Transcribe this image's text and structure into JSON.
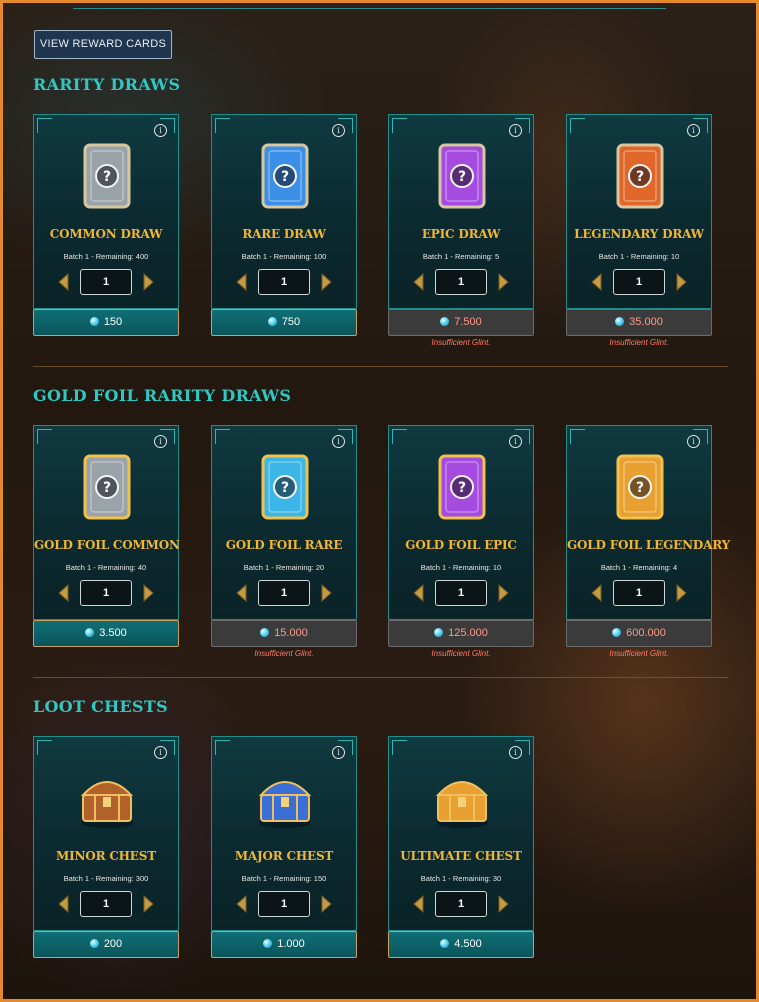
{
  "view_rewards_label": "VIEW REWARD CARDS",
  "sections": [
    {
      "title": "RARITY DRAWS",
      "cards": [
        {
          "name": "COMMON DRAW",
          "batch": "Batch 1 - Remaining: 400",
          "qty": "1",
          "price": "150",
          "affordable": true,
          "color": "#9aa3a8"
        },
        {
          "name": "RARE DRAW",
          "batch": "Batch 1 - Remaining: 100",
          "qty": "1",
          "price": "750",
          "affordable": true,
          "color": "#3b8fe6"
        },
        {
          "name": "EPIC DRAW",
          "batch": "Batch 1 - Remaining: 5",
          "qty": "1",
          "price": "7.500",
          "affordable": false,
          "error": "Insufficient Glint.",
          "color": "#a64be0"
        },
        {
          "name": "LEGENDARY DRAW",
          "batch": "Batch 1 - Remaining: 10",
          "qty": "1",
          "price": "35.000",
          "affordable": false,
          "error": "Insufficient Glint.",
          "color": "#e0662a"
        }
      ]
    },
    {
      "title": "GOLD FOIL RARITY DRAWS",
      "cards": [
        {
          "name": "GOLD FOIL COMMON",
          "batch": "Batch 1 - Remaining: 40",
          "qty": "1",
          "price": "3.500",
          "affordable": true,
          "color": "#9aa3a8"
        },
        {
          "name": "GOLD FOIL RARE",
          "batch": "Batch 1 - Remaining: 20",
          "qty": "1",
          "price": "15.000",
          "affordable": false,
          "error": "Insufficient Glint.",
          "color": "#3bb6e6"
        },
        {
          "name": "GOLD FOIL EPIC",
          "batch": "Batch 1 - Remaining: 10",
          "qty": "1",
          "price": "125.000",
          "affordable": false,
          "error": "Insufficient Glint.",
          "color": "#a64be0"
        },
        {
          "name": "GOLD FOIL LEGENDARY",
          "batch": "Batch 1 - Remaining: 4",
          "qty": "1",
          "price": "600.000",
          "affordable": false,
          "error": "Insufficient Glint.",
          "color": "#e8a030"
        }
      ]
    },
    {
      "title": "LOOT CHESTS",
      "cards": [
        {
          "name": "MINOR CHEST",
          "batch": "Batch 1 - Remaining: 300",
          "qty": "1",
          "price": "200",
          "affordable": true,
          "color": "#b0622a"
        },
        {
          "name": "MAJOR CHEST",
          "batch": "Batch 1 - Remaining: 150",
          "qty": "1",
          "price": "1.000",
          "affordable": true,
          "color": "#3a6fd6"
        },
        {
          "name": "ULTIMATE CHEST",
          "batch": "Batch 1 - Remaining: 30",
          "qty": "1",
          "price": "4.500",
          "affordable": true,
          "color": "#e8a030"
        }
      ]
    }
  ]
}
